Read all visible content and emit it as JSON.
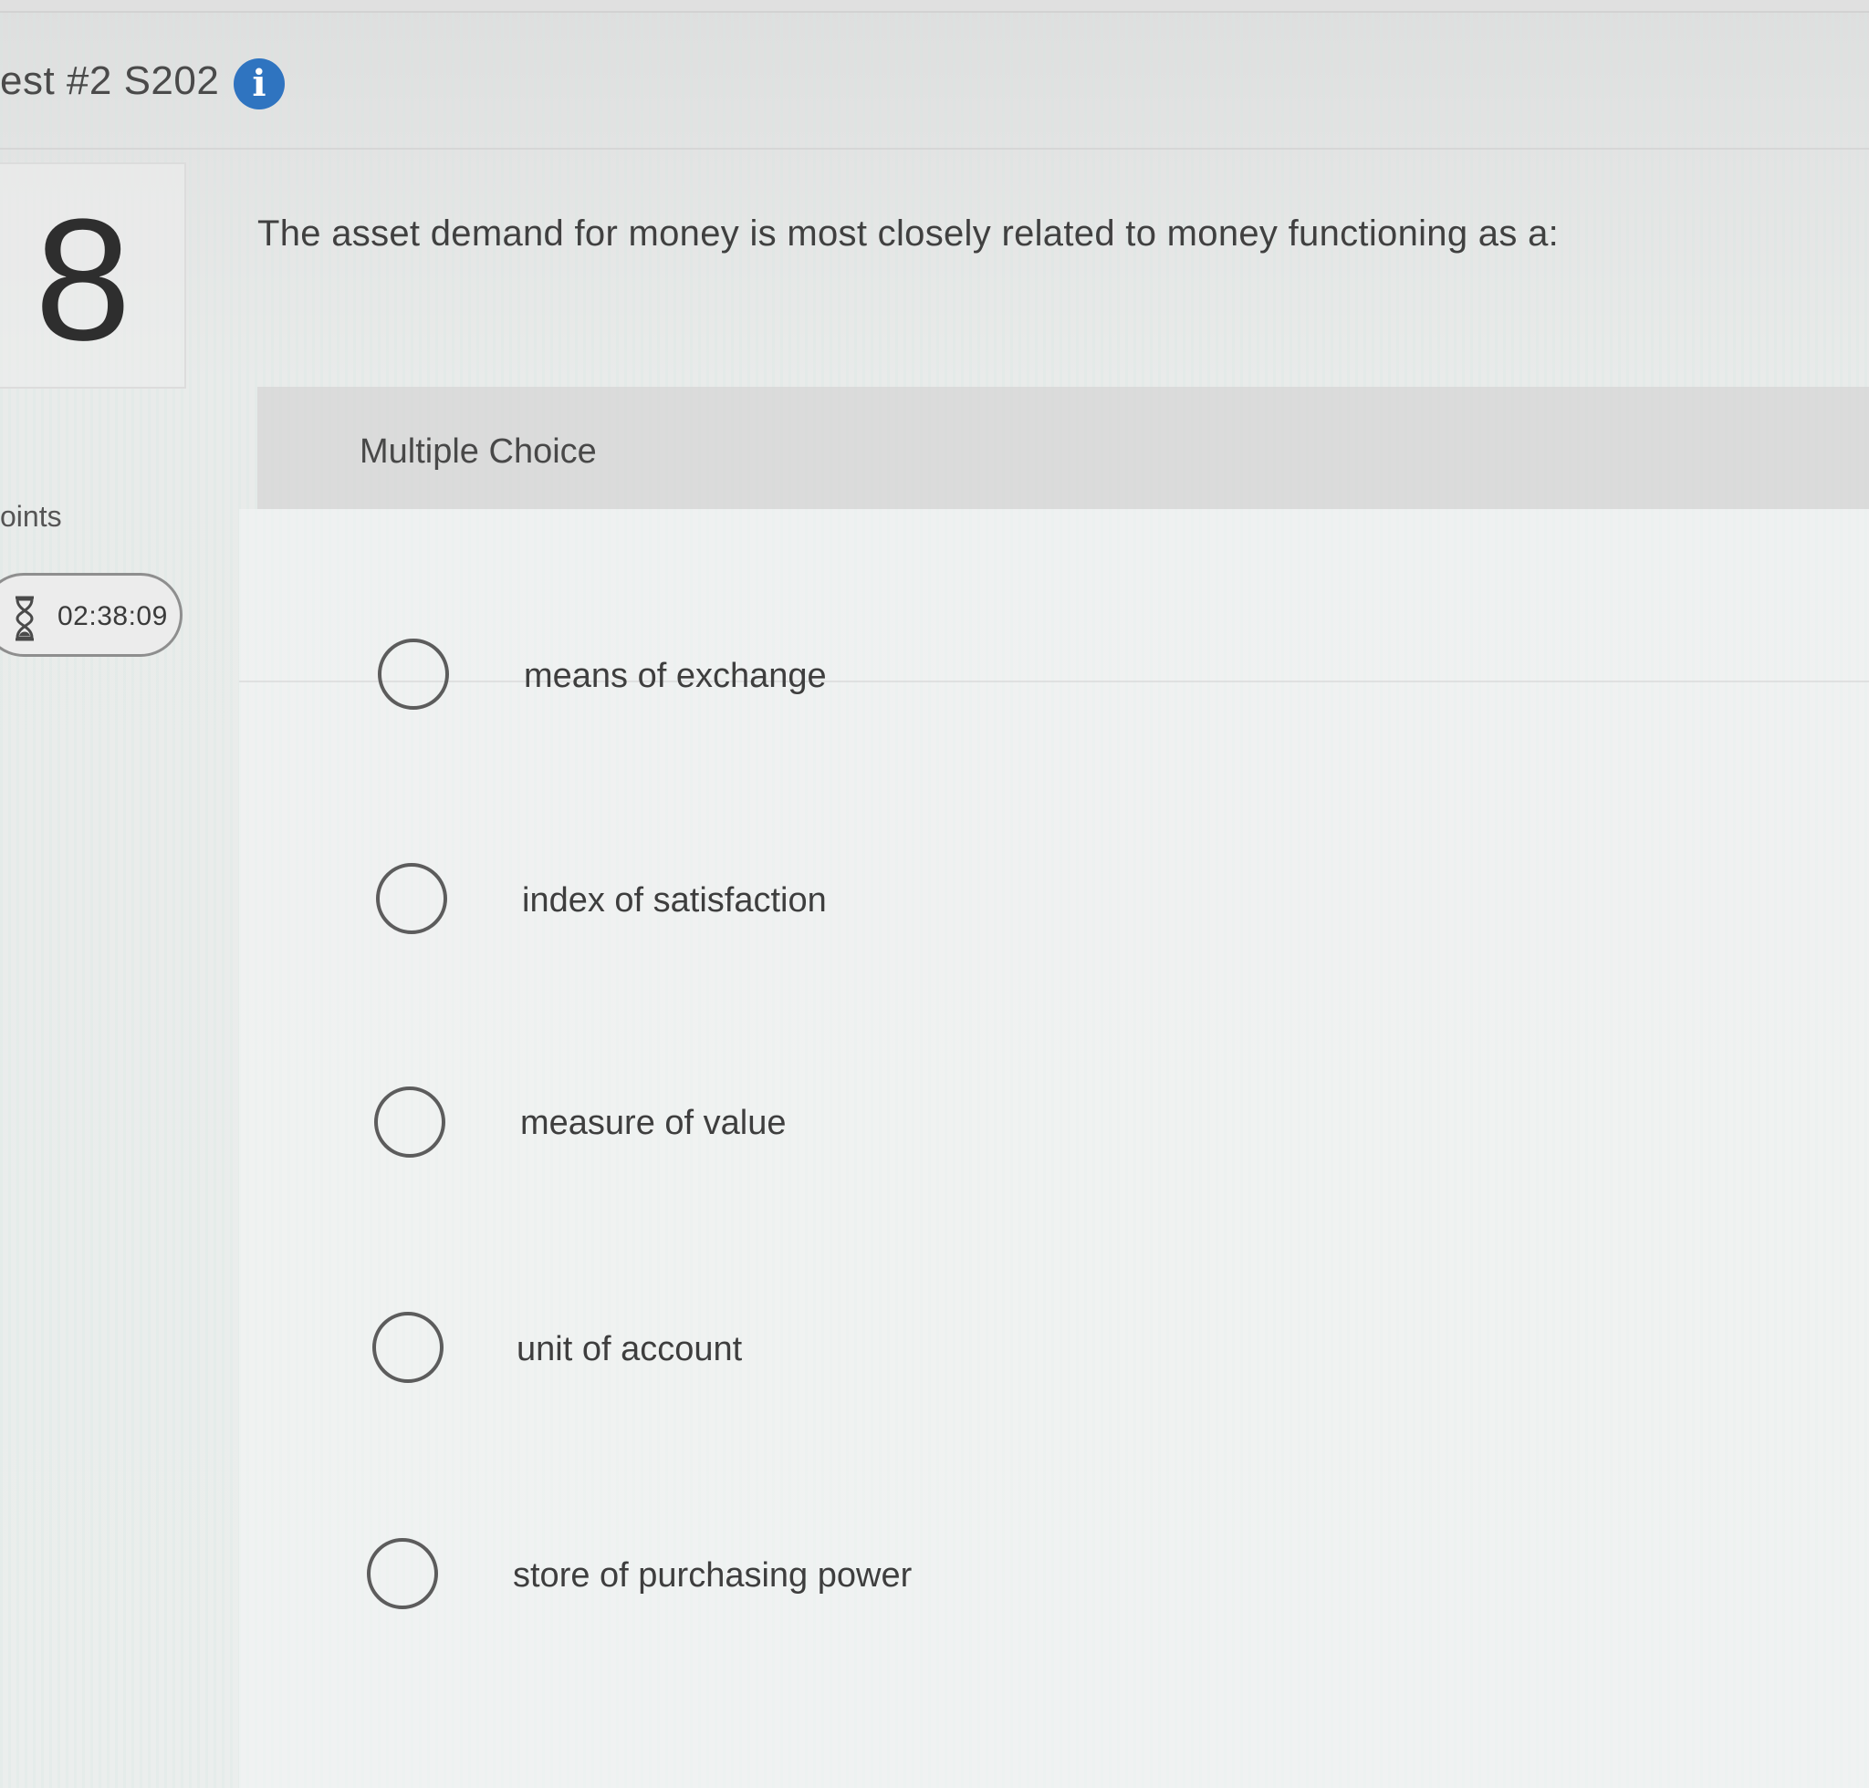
{
  "header": {
    "title": "est #2 S202",
    "info_icon": "info-icon"
  },
  "question": {
    "number": "8",
    "points_label": "oints",
    "timer": "02:38:09",
    "prompt": "The asset demand for money is most closely related to money functioning as a:",
    "type_label": "Multiple Choice",
    "options": [
      {
        "label": "means of exchange",
        "selected": false
      },
      {
        "label": "index of satisfaction",
        "selected": false
      },
      {
        "label": "measure of value",
        "selected": false
      },
      {
        "label": "unit of account",
        "selected": false
      },
      {
        "label": "store of purchasing power",
        "selected": false
      }
    ]
  },
  "colors": {
    "info_icon": "#2f74c0",
    "background": "#e9ebea",
    "radio_border": "#5c5c5c"
  }
}
